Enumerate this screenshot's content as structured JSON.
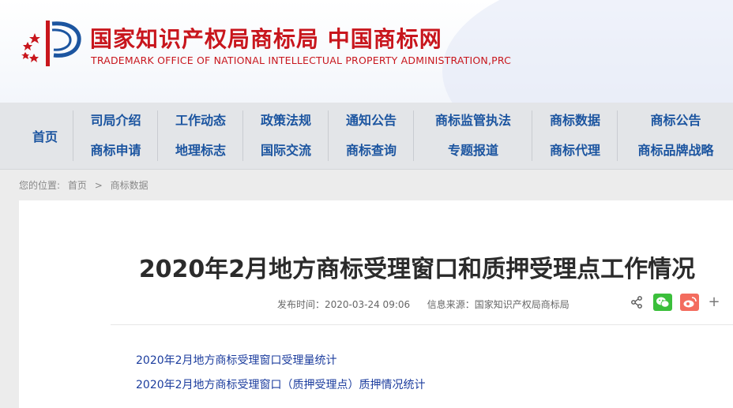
{
  "header": {
    "title_cn": "国家知识产权局商标局 中国商标网",
    "title_en": "TRADEMARK OFFICE OF NATIONAL INTELLECTUAL PROPERTY ADMINISTRATION,PRC",
    "logo_icon": "cnipa-logo-icon",
    "brand_red": "#c8161d",
    "brand_blue": "#1c55a0"
  },
  "nav": {
    "home": "首页",
    "columns": [
      {
        "top": "司局介绍",
        "bottom": "商标申请"
      },
      {
        "top": "工作动态",
        "bottom": "地理标志"
      },
      {
        "top": "政策法规",
        "bottom": "国际交流"
      },
      {
        "top": "通知公告",
        "bottom": "商标查询"
      },
      {
        "top": "商标监管执法",
        "bottom": "专题报道"
      },
      {
        "top": "商标数据",
        "bottom": "商标代理"
      },
      {
        "top": "商标公告",
        "bottom": "商标品牌战略"
      }
    ]
  },
  "breadcrumb": {
    "prefix": "您的位置:",
    "home": "首页",
    "separator": ">",
    "current": "商标数据"
  },
  "article": {
    "title": "2020年2月地方商标受理窗口和质押受理点工作情况",
    "publish_time": "发布时间：2020-03-24 09:06",
    "source": "信息来源：国家知识产权局商标局",
    "links": [
      "2020年2月地方商标受理窗口受理量统计",
      "2020年2月地方商标受理窗口（质押受理点）质押情况统计"
    ]
  },
  "share": {
    "icons": [
      "share-icon",
      "wechat-icon",
      "weibo-icon",
      "plus-icon"
    ],
    "plus": "+",
    "wechat_color": "#3bbf3b",
    "weibo_color": "#f36c5e"
  }
}
